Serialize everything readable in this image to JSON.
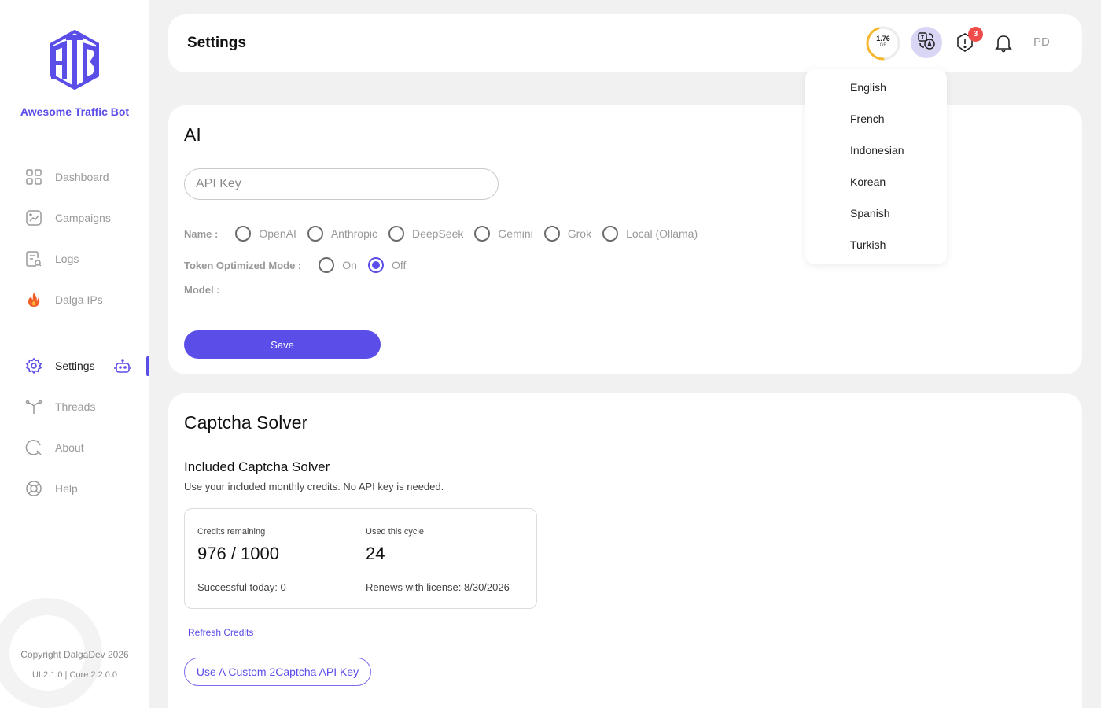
{
  "sidebar": {
    "brand": "Awesome Traffic Bot",
    "items": [
      {
        "label": "Dashboard"
      },
      {
        "label": "Campaigns"
      },
      {
        "label": "Logs"
      },
      {
        "label": "Dalga IPs"
      },
      {
        "label": "Settings"
      },
      {
        "label": "Threads"
      },
      {
        "label": "About"
      },
      {
        "label": "Help"
      }
    ],
    "active_item": "Settings",
    "copyright": "Copyright DalgaDev 2026",
    "version": "UI 2.1.0 | Core 2.2.0.0"
  },
  "header": {
    "title": "Settings",
    "memory_value": "1.76",
    "memory_unit": "GB",
    "memory_fraction": 0.45,
    "alert_count": "3",
    "avatar_initials": "PD"
  },
  "language_menu": {
    "options": [
      "English",
      "French",
      "Indonesian",
      "Korean",
      "Spanish",
      "Turkish"
    ]
  },
  "ai_section": {
    "title": "AI",
    "api_key_placeholder": "API Key",
    "name_label": "Name :",
    "providers": [
      "OpenAI",
      "Anthropic",
      "DeepSeek",
      "Gemini",
      "Grok",
      "Local (Ollama)"
    ],
    "token_mode_label": "Token Optimized Mode :",
    "token_mode_options": [
      "On",
      "Off"
    ],
    "token_mode_selected": "Off",
    "model_label": "Model :",
    "save_label": "Save"
  },
  "captcha_section": {
    "title": "Captcha Solver",
    "subtitle": "Included Captcha Solver",
    "description": "Use your included monthly credits. No API key is needed.",
    "credits_remaining_label": "Credits remaining",
    "credits_remaining_value": "976 / 1000",
    "used_cycle_label": "Used this cycle",
    "used_cycle_value": "24",
    "successful_today": "Successful today: 0",
    "renews": "Renews with license: 8/30/2026",
    "refresh_label": "Refresh Credits",
    "custom_key_label": "Use A Custom 2Captcha API Key"
  },
  "colors": {
    "accent": "#5b4de8",
    "gauge": "#f5b82e",
    "badge": "#f04b4b"
  }
}
